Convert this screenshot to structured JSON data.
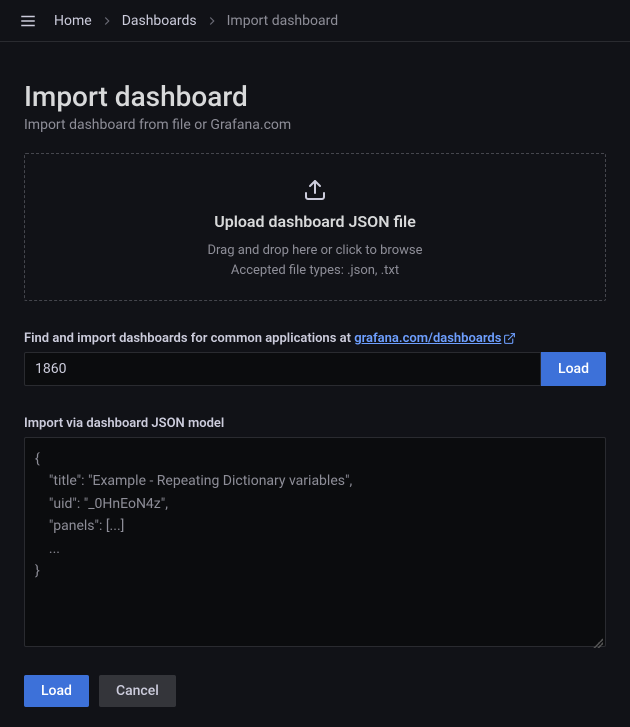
{
  "breadcrumb": {
    "items": [
      {
        "label": "Home"
      },
      {
        "label": "Dashboards"
      },
      {
        "label": "Import dashboard"
      }
    ]
  },
  "page": {
    "title": "Import dashboard",
    "subtitle": "Import dashboard from file or Grafana.com"
  },
  "upload": {
    "heading": "Upload dashboard JSON file",
    "hint_line1": "Drag and drop here or click to browse",
    "hint_line2": "Accepted file types: .json, .txt"
  },
  "find": {
    "label_prefix": "Find and import dashboards for common applications at ",
    "link_text": "grafana.com/dashboards",
    "input_value": "1860",
    "load_label": "Load"
  },
  "json": {
    "label": "Import via dashboard JSON model",
    "textarea_value": "{\n    \"title\": \"Example - Repeating Dictionary variables\",\n    \"uid\": \"_0HnEoN4z\",\n    \"panels\": [...]\n    ...\n}"
  },
  "actions": {
    "load": "Load",
    "cancel": "Cancel"
  }
}
